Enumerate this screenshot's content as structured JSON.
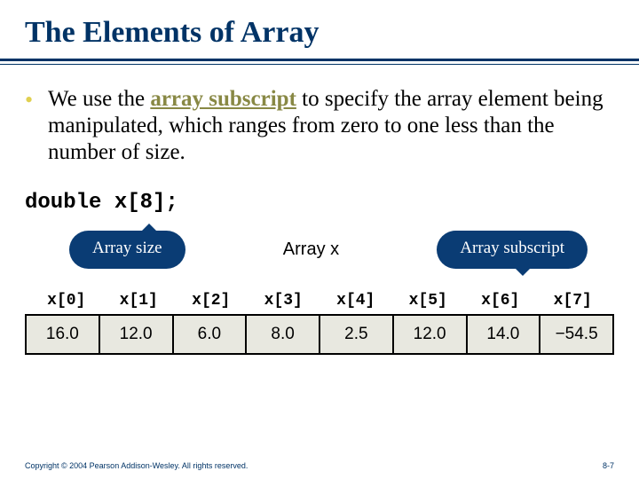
{
  "title": "The Elements of Array",
  "bullet": {
    "pre": "We use the ",
    "keyword": "array subscript",
    "post": " to specify the array element being manipulated, which ranges from zero to one less than the number of size."
  },
  "code_declaration": "double x[8];",
  "callouts": {
    "size": "Array size",
    "subscript": "Array subscript"
  },
  "array_caption": "Array x",
  "array": {
    "indices": [
      "x[0]",
      "x[1]",
      "x[2]",
      "x[3]",
      "x[4]",
      "x[5]",
      "x[6]",
      "x[7]"
    ],
    "values": [
      "16.0",
      "12.0",
      "6.0",
      "8.0",
      "2.5",
      "12.0",
      "14.0",
      "−54.5"
    ]
  },
  "footer": {
    "copyright": "Copyright © 2004 Pearson Addison-Wesley. All rights reserved.",
    "page": "8-7"
  }
}
